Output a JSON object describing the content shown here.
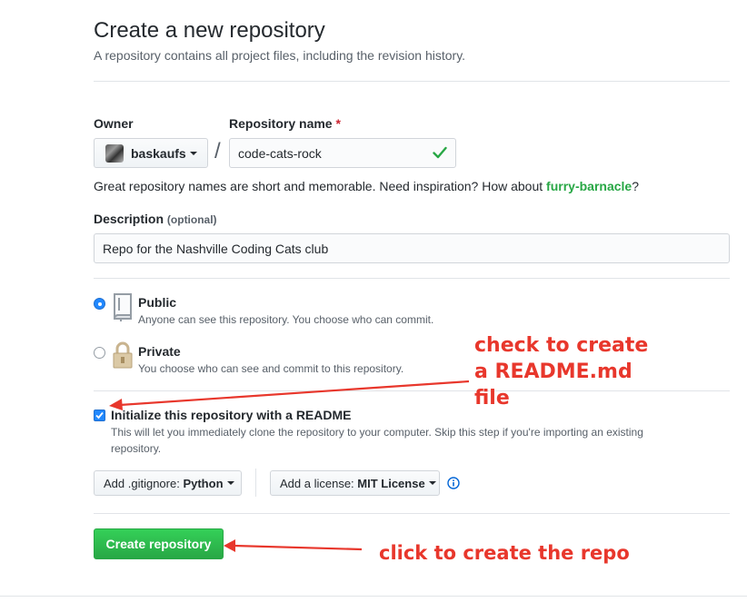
{
  "header": {
    "title": "Create a new repository",
    "subtitle": "A repository contains all project files, including the revision history."
  },
  "owner": {
    "label": "Owner",
    "value": "baskaufs"
  },
  "repo_name": {
    "label": "Repository name",
    "required_mark": "*",
    "value": "code-cats-rock",
    "separator": "/"
  },
  "hint": {
    "prefix": "Great repository names are short and memorable. Need inspiration? How about ",
    "suggestion": "furry-barnacle",
    "suffix": "?"
  },
  "description": {
    "label": "Description",
    "optional": "(optional)",
    "value": "Repo for the Nashville Coding Cats club"
  },
  "visibility": {
    "public": {
      "title": "Public",
      "desc": "Anyone can see this repository. You choose who can commit.",
      "selected": true
    },
    "private": {
      "title": "Private",
      "desc": "You choose who can see and commit to this repository.",
      "selected": false
    }
  },
  "readme": {
    "label": "Initialize this repository with a README",
    "desc_line1": "This will let you immediately clone the repository to your computer. Skip this step if you're importing an existing",
    "desc_line2": "repository.",
    "checked": true
  },
  "gitignore": {
    "prefix": "Add .gitignore: ",
    "value": "Python"
  },
  "license": {
    "prefix": "Add a license: ",
    "value": "MIT License"
  },
  "create_button": {
    "label": "Create repository"
  },
  "annotations": {
    "readme_line1": "check to create",
    "readme_line2": "a README.md",
    "readme_line3": "file",
    "create": "click to create the repo"
  },
  "colors": {
    "accent": "#2188ff",
    "green": "#28a745",
    "annotation": "#e8372c"
  },
  "icons": [
    "avatar",
    "caret-down-icon",
    "check-icon",
    "repo-icon",
    "lock-icon",
    "info-icon"
  ]
}
